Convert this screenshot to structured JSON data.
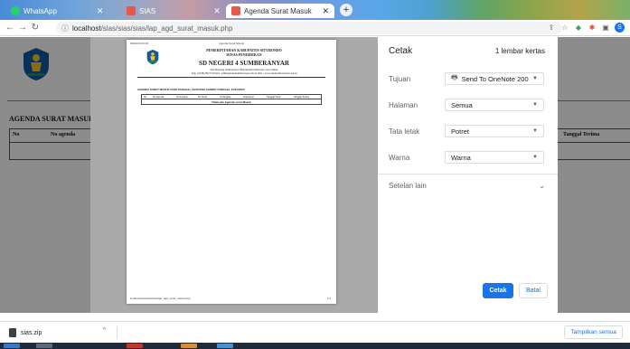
{
  "browser": {
    "tabs": [
      {
        "label": "WhatsApp",
        "active": false
      },
      {
        "label": "SIAS",
        "active": false
      },
      {
        "label": "Agenda Surat Masuk",
        "active": true
      }
    ],
    "new_tab": "+",
    "url_host": "localhost",
    "url_path": "/sias/sias/sias/lap_agd_surat_masuk.php",
    "info_icon": "info-icon"
  },
  "background_page": {
    "title": "AGENDA SURAT MASUK DARI",
    "col_no": "No",
    "col_agenda": "No agenda",
    "col_tanggal": "Tanggal Terima"
  },
  "preview": {
    "header_date": "09/02/23 06:36",
    "header_title": "Agenda Surat Masuk",
    "kop_1": "PEMERINTAHAN KABUPATEN SITUBONDO",
    "kop_2": "DINAS PENDIDIKAN",
    "kop_3": "SD NEGERI 4 SUMBERANYAR",
    "kop_4": "Dsn Banteng Sumberanyar Banyuputih Situbondo Jawa Timur",
    "kop_5": "Telp. (0338) 99775 Email : admin@sdn4sumberanyar.sch.id Web : www.sdn4sumberanyar.sch.id",
    "subtitle": "AGENDA SURAT MASUK DARI TANGGAL 01/01/2023 SAMPAI TANGGAL 31/01/2023",
    "columns": [
      "No",
      "No agenda",
      "Jenis Surat",
      "No Surat",
      "Isi Ringkas",
      "Asal Surat",
      "Tanggal Surat",
      "Tanggal Terima"
    ],
    "empty_text": "Tidak ada Agenda surat Masuk",
    "footer_url": "localhost/sias/sias/sias/lap_agd_surat_masuk.php",
    "footer_page": "1/1"
  },
  "print_panel": {
    "title": "Cetak",
    "sheet_count": "1 lembar kertas",
    "rows": [
      {
        "label": "Tujuan",
        "value": "Send To OneNote 200"
      },
      {
        "label": "Halaman",
        "value": "Semua"
      },
      {
        "label": "Tata letak",
        "value": "Potret"
      },
      {
        "label": "Warna",
        "value": "Warna"
      }
    ],
    "more_settings": "Setelan lain",
    "print_button": "Cetak",
    "cancel_button": "Batal"
  },
  "downloads": {
    "file_name": "sias.zip",
    "show_all": "Tampilkan semua"
  },
  "colors": {
    "accent": "#1a73e8",
    "overlay": "#000000"
  }
}
